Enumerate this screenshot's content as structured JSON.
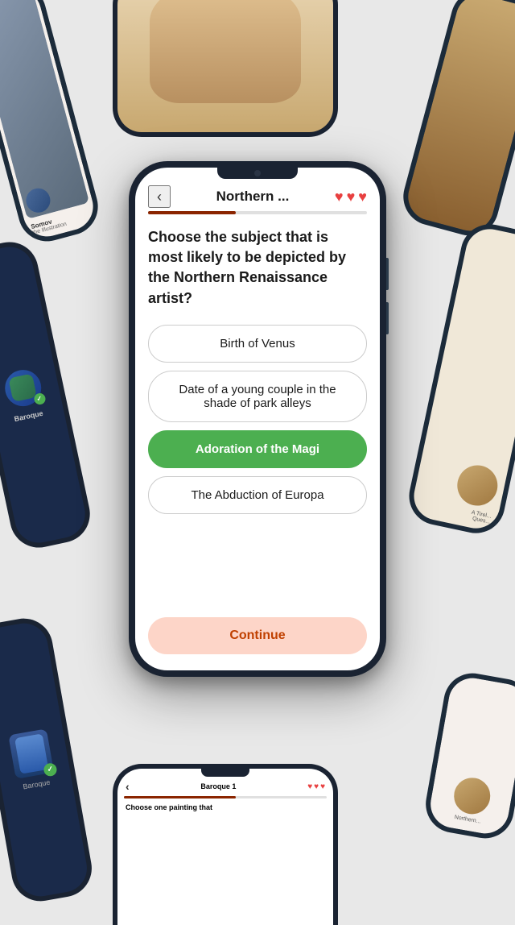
{
  "page": {
    "background_color": "#e8e8e8"
  },
  "main_phone": {
    "header": {
      "back_label": "‹",
      "title": "Northern ...",
      "hearts": [
        "♥",
        "♥",
        "♥"
      ]
    },
    "progress_percent": 40,
    "question": "Choose the subject that is most likely to be depicted by the Northern Renaissance artist?",
    "options": [
      {
        "id": "a",
        "label": "Birth of Venus",
        "state": "normal"
      },
      {
        "id": "b",
        "label": "Date of a young couple in the shade of park alleys",
        "state": "normal"
      },
      {
        "id": "c",
        "label": "Adoration of the Magi",
        "state": "correct"
      },
      {
        "id": "d",
        "label": "The Abduction of Europa",
        "state": "normal"
      }
    ],
    "continue_label": "Continue"
  },
  "bottom_phone": {
    "header": {
      "back_label": "‹",
      "title": "Baroque 1",
      "hearts": [
        "♥",
        "♥",
        "♥"
      ]
    },
    "progress_percent": 55,
    "question": "Choose one painting that"
  },
  "left_phone": {
    "title": "Somov",
    "subtitle": "the Illustration"
  },
  "right_phone": {
    "label": "A Tirel...\nQues..."
  },
  "bottom_left_phone": {
    "label": "Baroque"
  },
  "icons": {
    "heart": "♥",
    "back_arrow": "‹",
    "check": "✓"
  }
}
